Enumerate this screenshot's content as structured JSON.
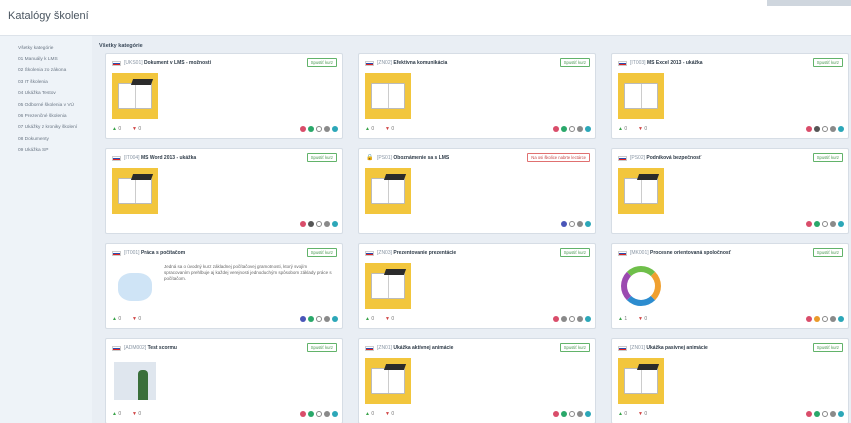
{
  "header": {
    "title": "Katalógy školení"
  },
  "sidebar": {
    "items": [
      "Všetky kategórie",
      "01 Manuály k LMS",
      "02 Školenia zo zákona",
      "03 IT školenia",
      "04 Ukážka Testov",
      "05 Odborné školenia v VÚ",
      "06 Prezenčné školenia",
      "07 Ukážky z kroniky školení",
      "08 Dokumenty",
      "09 Ukážka SP"
    ]
  },
  "main": {
    "section_title": "Všetky kategórie",
    "cards": [
      {
        "code": "[UKS01]",
        "name": "Dokument v LMS - možnosti",
        "button": "Spustiť kurz",
        "up": "0",
        "down": "0"
      },
      {
        "code": "[ZN02]",
        "name": "Efektívna komunikácia",
        "button": "Spustiť kurz",
        "up": "0",
        "down": "0"
      },
      {
        "code": "[IT003]",
        "name": "MS Excel 2013 - ukážka",
        "button": "Spustiť kurz",
        "up": "0",
        "down": "0"
      },
      {
        "code": "[IT004]",
        "name": "MS Word 2013 - ukážka",
        "button": "Spustiť kurz",
        "up": "0",
        "down": "0"
      },
      {
        "code": "[PS01]",
        "name": "Oboznámenie sa s LMS",
        "button": "Na osi školice nabrte lectárce",
        "up": "",
        "down": ""
      },
      {
        "code": "[PS02]",
        "name": "Podniková bezpečnosť",
        "button": "Spustiť kurz",
        "up": "0",
        "down": "0"
      },
      {
        "code": "[IT001]",
        "name": "Práca s počítačom",
        "button": "Spustiť kurz",
        "up": "0",
        "down": "0",
        "desc": "Jedná sa o úvodný kurz základnej počítačovej gramotnosti, ktorý svojím spracovaním prehlbuje aj každej verejnosti jednoduchým spôsobom základy práce s počítačom."
      },
      {
        "code": "[ZN03]",
        "name": "Prezentovanie prezentácie",
        "button": "Spustiť kurz",
        "up": "0",
        "down": "0"
      },
      {
        "code": "[MK001]",
        "name": "Procesne orientovaná spoločnosť",
        "button": "Spustiť kurz",
        "up": "1",
        "down": "0"
      },
      {
        "code": "[ADM002]",
        "name": "Test scormu",
        "button": "Spustiť kurz",
        "up": "0",
        "down": "0"
      },
      {
        "code": "[ZN01]",
        "name": "Ukážka aktívnej animácie",
        "button": "Spustiť kurz",
        "up": "0",
        "down": "0"
      },
      {
        "code": "[ZN01]",
        "name": "Ukážka pasívnej animácie",
        "button": "Spustiť kurz",
        "up": "0",
        "down": "0"
      }
    ]
  },
  "colors": {
    "accent_green": "#62b36a",
    "thumb_yellow": "#f2c63d",
    "background": "#e9eef4"
  }
}
